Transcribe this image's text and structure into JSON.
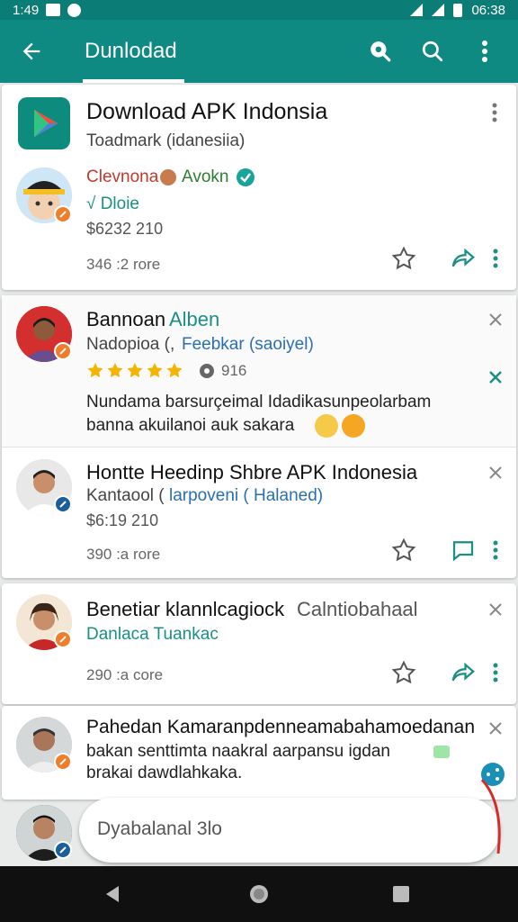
{
  "status_bar": {
    "time_left": "1:49",
    "time_right": "06:38"
  },
  "app_bar": {
    "title": "Dunlodad"
  },
  "posts": [
    {
      "title": "Download APK Indonsia",
      "subtitle": "Toadmark (idanesiia)",
      "author_name": "Clevnona",
      "author_name2": "Avokn",
      "badge_text": "√ Dloie",
      "price": "$6232 210",
      "meta": "346 :2 rore"
    },
    {
      "title": "Bannoan",
      "title_colored": "Alben",
      "subtitle_a": "Nadopioa (,",
      "subtitle_b": "Feebkar (saoiyel)",
      "rating_count": "916",
      "body_line1": "Nundama barsurçeimal Idadikasunpeolarbam",
      "body_line2": "banna akuilanoi auk sakara"
    },
    {
      "title": "Hontte Heedinp Shbre APK Indonesia",
      "subtitle_a": "Kantaool (",
      "subtitle_b": "larpoveni ( Halaned)",
      "price": "$6:19 210",
      "meta": "390 :a rore"
    },
    {
      "title": "Benetiar klannlcagiock",
      "title_gray": "Calntiobahaal",
      "subtitle": "Danlaca Tuankac",
      "meta": "290 :a core"
    },
    {
      "title": "Pahedan Kamaranpdenneamabahamoedanan",
      "body_line1": "bakan senttimta naakral aarpansu igdan",
      "body_line2": "brakai dawdlahkaka."
    }
  ],
  "compose": {
    "placeholder": "Dyabalanal 3lo"
  },
  "colors": {
    "primary": "#0f8a82",
    "accent_orange": "#f07d2a",
    "star": "#f4b400",
    "link_teal": "#1a8f85"
  }
}
